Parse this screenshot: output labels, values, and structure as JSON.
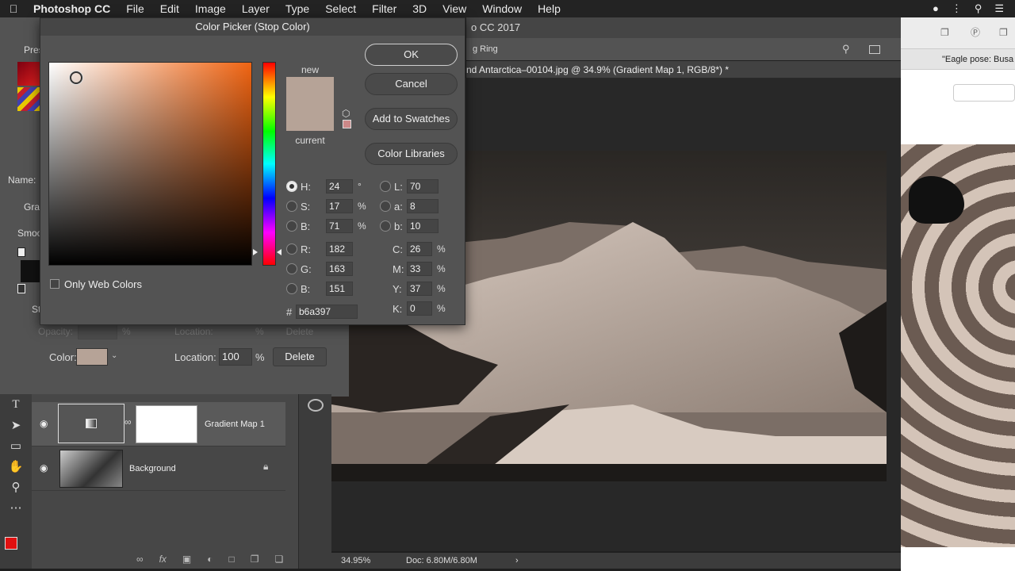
{
  "menubar": {
    "app": "Photoshop CC",
    "items": [
      "File",
      "Edit",
      "Image",
      "Layer",
      "Type",
      "Select",
      "Filter",
      "3D",
      "View",
      "Window",
      "Help"
    ]
  },
  "ps": {
    "title": "o CC 2017",
    "option_text": "g Ring",
    "doc_tab": "nd Antarctica–00104.jpg @ 34.9% (Gradient Map 1, RGB/8*) *",
    "status_zoom": "34.95%",
    "status_doc": "Doc: 6.80M/6.80M"
  },
  "leftpanel": {
    "pre": "Pres",
    "name_label": "Name:",
    "gra": "Gra",
    "smoo": "Smoo",
    "st": "St"
  },
  "stops": {
    "opacity_label": "Opacity:",
    "opacity_unit": "%",
    "location_label": "Location:",
    "location_unit": "%",
    "delete_label": "Delete",
    "color_label": "Color:",
    "color_swatch": "#b6a397",
    "location_value": "100"
  },
  "layers": [
    {
      "name": "Gradient Map 1"
    },
    {
      "name": "Background"
    }
  ],
  "browser": {
    "tab": "\"Eagle pose: Busa"
  },
  "dialog": {
    "title": "Color Picker (Stop Color)",
    "ok": "OK",
    "cancel": "Cancel",
    "add_swatches": "Add to Swatches",
    "color_libraries": "Color Libraries",
    "new_label": "new",
    "current_label": "current",
    "new_color": "#b6a397",
    "current_color": "#b6a397",
    "only_web": "Only Web Colors",
    "hex_label": "#",
    "hex": "b6a397",
    "fields": {
      "H": {
        "label": "H:",
        "value": "24",
        "unit": "°"
      },
      "S": {
        "label": "S:",
        "value": "17",
        "unit": "%"
      },
      "B": {
        "label": "B:",
        "value": "71",
        "unit": "%"
      },
      "R": {
        "label": "R:",
        "value": "182"
      },
      "G": {
        "label": "G:",
        "value": "163"
      },
      "B2": {
        "label": "B:",
        "value": "151"
      },
      "L": {
        "label": "L:",
        "value": "70"
      },
      "a": {
        "label": "a:",
        "value": "8"
      },
      "b": {
        "label": "b:",
        "value": "10"
      },
      "C": {
        "label": "C:",
        "value": "26",
        "unit": "%"
      },
      "M": {
        "label": "M:",
        "value": "33",
        "unit": "%"
      },
      "Y": {
        "label": "Y:",
        "value": "37",
        "unit": "%"
      },
      "K": {
        "label": "K:",
        "value": "0",
        "unit": "%"
      }
    }
  }
}
